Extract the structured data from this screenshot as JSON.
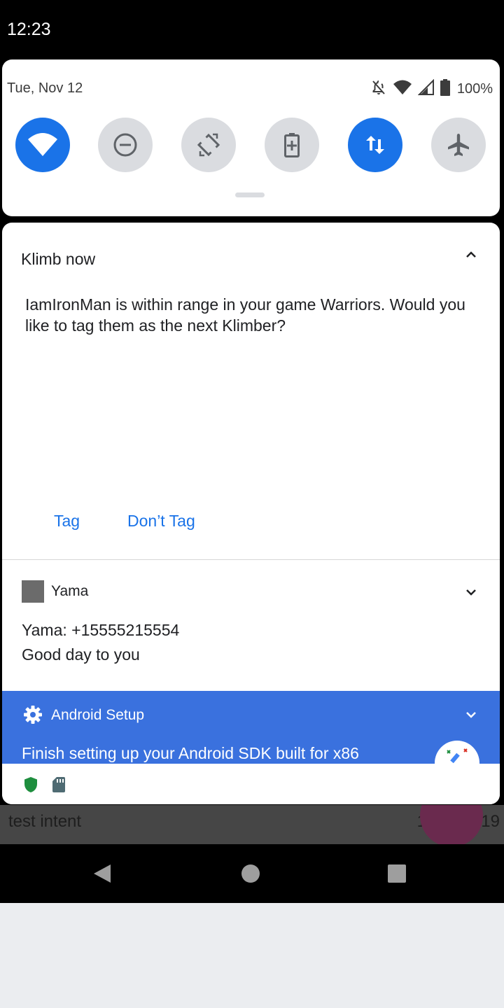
{
  "status_bar": {
    "time": "12:23"
  },
  "quick_settings": {
    "date": "Tue, Nov 12",
    "battery_percent": "100%",
    "tiles": [
      {
        "name": "wifi",
        "active": true
      },
      {
        "name": "do-not-disturb",
        "active": false
      },
      {
        "name": "auto-rotate",
        "active": false
      },
      {
        "name": "battery-saver",
        "active": false
      },
      {
        "name": "mobile-data",
        "active": true
      },
      {
        "name": "airplane-mode",
        "active": false
      }
    ]
  },
  "notifications": {
    "klimb": {
      "app_name": "Klimb now",
      "body": "IamIronMan is within range in your game Warriors. Would you like to tag them as the next Klimber?",
      "actions": {
        "tag": "Tag",
        "dont_tag": "Don’t Tag"
      }
    },
    "yama": {
      "app_name": "Yama",
      "line1": "Yama: +15555215554",
      "line2": "Good day to you"
    },
    "android_setup": {
      "app_name": "Android Setup",
      "text": "Finish setting up your Android SDK built for x86"
    }
  },
  "background_app": {
    "item_text": "test intent",
    "item_date": "11/12/2019"
  },
  "colors": {
    "accent": "#1a73e8",
    "setup_bg": "#3a71de",
    "tile_inactive": "#dadce0"
  }
}
